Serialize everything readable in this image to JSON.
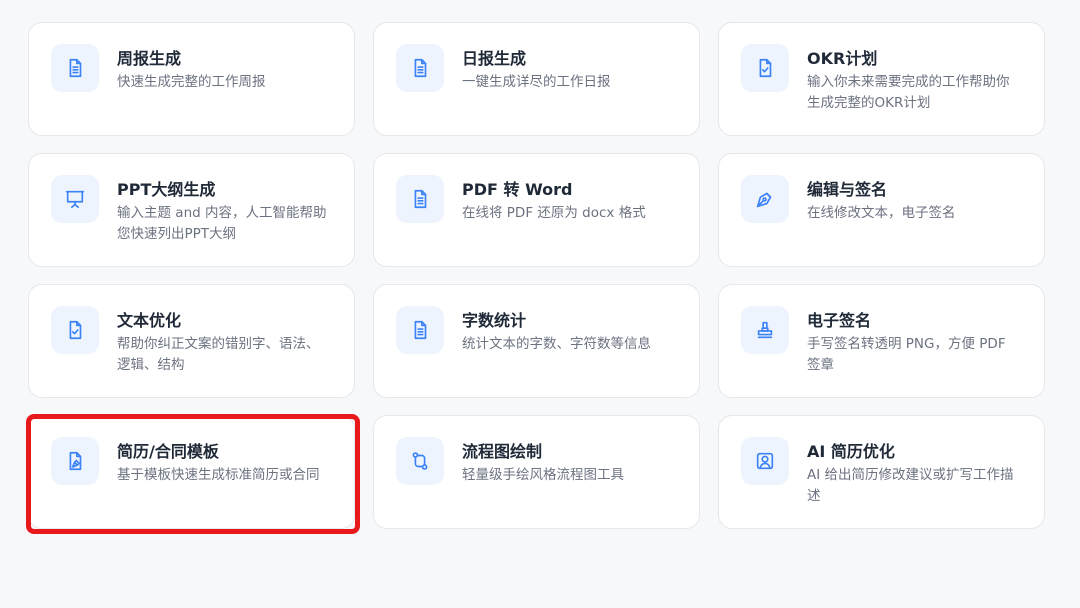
{
  "tools": [
    {
      "title": "周报生成",
      "desc": "快速生成完整的工作周报",
      "icon": "document-icon"
    },
    {
      "title": "日报生成",
      "desc": "一键生成详尽的工作日报",
      "icon": "document-icon"
    },
    {
      "title": "OKR计划",
      "desc": "输入你未来需要完成的工作帮助你生成完整的OKR计划",
      "icon": "document-check-icon"
    },
    {
      "title": "PPT大纲生成",
      "desc": "输入主题 and 内容，人工智能帮助您快速列出PPT大纲",
      "icon": "presentation-icon"
    },
    {
      "title": "PDF 转 Word",
      "desc": "在线将 PDF 还原为 docx 格式",
      "icon": "document-icon"
    },
    {
      "title": "编辑与签名",
      "desc": "在线修改文本，电子签名",
      "icon": "pen-nib-icon"
    },
    {
      "title": "文本优化",
      "desc": "帮助你纠正文案的错别字、语法、逻辑、结构",
      "icon": "document-check-icon"
    },
    {
      "title": "字数统计",
      "desc": "统计文本的字数、字符数等信息",
      "icon": "document-icon"
    },
    {
      "title": "电子签名",
      "desc": "手写签名转透明 PNG，方便 PDF 签章",
      "icon": "stamp-icon"
    },
    {
      "title": "简历/合同模板",
      "desc": "基于模板快速生成标准简历或合同",
      "icon": "document-signature-icon"
    },
    {
      "title": "流程图绘制",
      "desc": "轻量级手绘风格流程图工具",
      "icon": "flow-route-icon"
    },
    {
      "title": "AI 简历优化",
      "desc": "AI 给出简历修改建议或扩写工作描述",
      "icon": "user-profile-icon"
    }
  ],
  "highlighted": "简历/合同模板",
  "colors": {
    "accent": "#3b82f6",
    "icon_bg": "#eef4fd",
    "highlight": "#e8191a"
  }
}
